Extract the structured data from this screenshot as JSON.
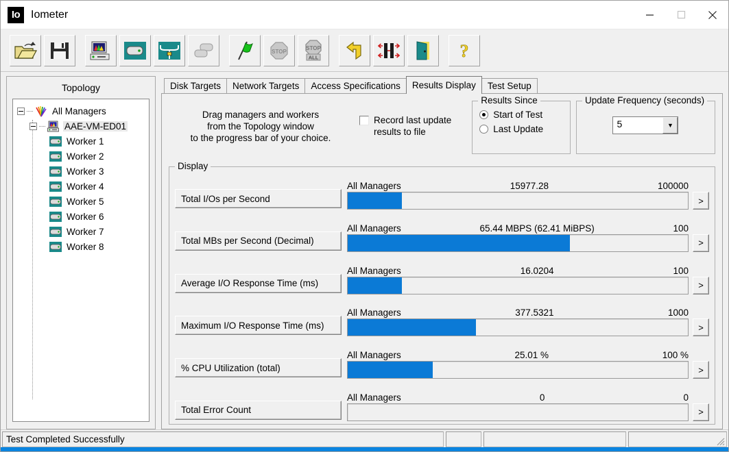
{
  "window": {
    "title": "Iometer",
    "icon_label": "Io",
    "icon_name": "iometer-logo-icon",
    "minimize": "—",
    "maximize": "☐",
    "close": "✕"
  },
  "toolbar": {
    "buttons": [
      {
        "name": "open-test-config-icon",
        "title": "Open Test Configuration"
      },
      {
        "name": "save-test-config-icon",
        "title": "Save Test Configuration"
      },
      {
        "name": "add-manager-icon",
        "title": "Add Manager"
      },
      {
        "name": "add-worker-icon",
        "title": "Add Worker"
      },
      {
        "name": "disconnect-icon",
        "title": "Disconnect"
      },
      {
        "name": "duplicate-worker-icon",
        "title": "Duplicate Worker"
      },
      {
        "name": "start-tests-flag-icon",
        "title": "Start Tests"
      },
      {
        "name": "stop-test-icon",
        "title": "Stop Test"
      },
      {
        "name": "stop-all-tests-icon",
        "title": "Stop All Tests"
      },
      {
        "name": "reset-workers-icon",
        "title": "Reset Workers"
      },
      {
        "name": "swap-workers-icon",
        "title": "Swap Workers"
      },
      {
        "name": "exit-door-icon",
        "title": "Exit"
      },
      {
        "name": "help-question-icon",
        "title": "Help"
      }
    ]
  },
  "topology": {
    "title": "Topology",
    "nodes": [
      {
        "label": "All Managers",
        "level": 0,
        "icon": "all-managers-rainbow-icon",
        "expander": true,
        "selected": false
      },
      {
        "label": "AAE-VM-ED01",
        "level": 1,
        "icon": "manager-computer-icon",
        "expander": true,
        "selected": true
      },
      {
        "label": "Worker 1",
        "level": 2,
        "icon": "worker-icon",
        "expander": false,
        "selected": false
      },
      {
        "label": "Worker 2",
        "level": 2,
        "icon": "worker-icon",
        "expander": false,
        "selected": false
      },
      {
        "label": "Worker 3",
        "level": 2,
        "icon": "worker-icon",
        "expander": false,
        "selected": false
      },
      {
        "label": "Worker 4",
        "level": 2,
        "icon": "worker-icon",
        "expander": false,
        "selected": false
      },
      {
        "label": "Worker 5",
        "level": 2,
        "icon": "worker-icon",
        "expander": false,
        "selected": false
      },
      {
        "label": "Worker 6",
        "level": 2,
        "icon": "worker-icon",
        "expander": false,
        "selected": false
      },
      {
        "label": "Worker 7",
        "level": 2,
        "icon": "worker-icon",
        "expander": false,
        "selected": false
      },
      {
        "label": "Worker 8",
        "level": 2,
        "icon": "worker-icon",
        "expander": false,
        "selected": false
      }
    ]
  },
  "tabs": [
    {
      "label": "Disk Targets",
      "active": false
    },
    {
      "label": "Network Targets",
      "active": false
    },
    {
      "label": "Access Specifications",
      "active": false
    },
    {
      "label": "Results Display",
      "active": true
    },
    {
      "label": "Test Setup",
      "active": false
    }
  ],
  "results_display": {
    "hint_line1": "Drag managers and workers",
    "hint_line2": "from the Topology window",
    "hint_line3": "to the progress bar of your choice.",
    "record_checkbox": {
      "label_line1": "Record last update",
      "label_line2": "results to file",
      "checked": false
    },
    "results_since": {
      "title": "Results Since",
      "options": [
        {
          "label": "Start of Test",
          "selected": true
        },
        {
          "label": "Last Update",
          "selected": false
        }
      ]
    },
    "update_frequency": {
      "title": "Update Frequency (seconds)",
      "value": "5",
      "arrow": "▼"
    },
    "display_group_title": "Display",
    "arrow_button_label": ">",
    "bar_color": "#0b7ad6",
    "metrics": [
      {
        "label": "Total I/Os per Second",
        "source": "All Managers",
        "value": "15977.28",
        "max": "100000",
        "percent": 16.0
      },
      {
        "label": "Total MBs per Second (Decimal)",
        "source": "All Managers",
        "value": "65.44 MBPS (62.41 MiBPS)",
        "max": "100",
        "percent": 65.4
      },
      {
        "label": "Average I/O Response Time (ms)",
        "source": "All Managers",
        "value": "16.0204",
        "max": "100",
        "percent": 16.0
      },
      {
        "label": "Maximum I/O Response Time (ms)",
        "source": "All Managers",
        "value": "377.5321",
        "max": "1000",
        "percent": 37.8
      },
      {
        "label": "% CPU Utilization (total)",
        "source": "All Managers",
        "value": "25.01 %",
        "max": "100 %",
        "percent": 25.0
      },
      {
        "label": "Total Error Count",
        "source": "All Managers",
        "value": "0",
        "max": "0",
        "percent": 0
      }
    ]
  },
  "statusbar": {
    "message": "Test Completed Successfully",
    "panel2": "",
    "panel3": "",
    "panel4": ""
  }
}
